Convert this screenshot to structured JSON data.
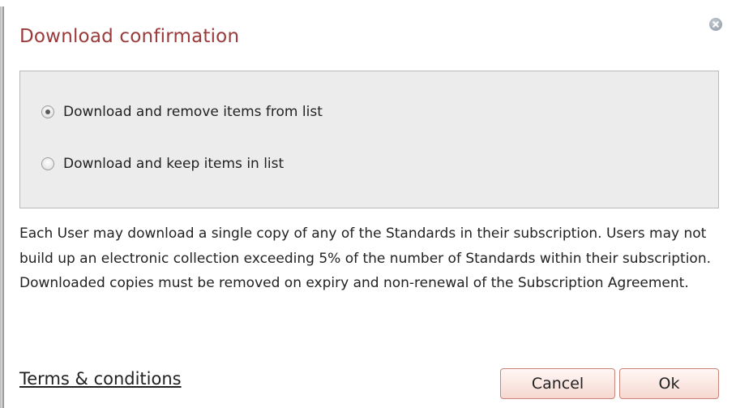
{
  "dialog": {
    "title": "Download confirmation",
    "close_icon": "close-icon"
  },
  "options": [
    {
      "label": "Download and remove items from list",
      "checked": true
    },
    {
      "label": "Download and keep items in list",
      "checked": false
    }
  ],
  "policy_text": "Each User may download a single copy of any of the Standards in their subscription. Users may not build up an electronic collection exceeding 5% of the number of Standards within their subscription. Downloaded copies must be removed on expiry and non-renewal of the Subscription Agreement.",
  "footer": {
    "terms_link": "Terms & conditions",
    "cancel_label": "Cancel",
    "ok_label": "Ok"
  },
  "colors": {
    "title": "#9a3a3a",
    "options_background": "#ececec",
    "button_border": "#c9857a"
  }
}
